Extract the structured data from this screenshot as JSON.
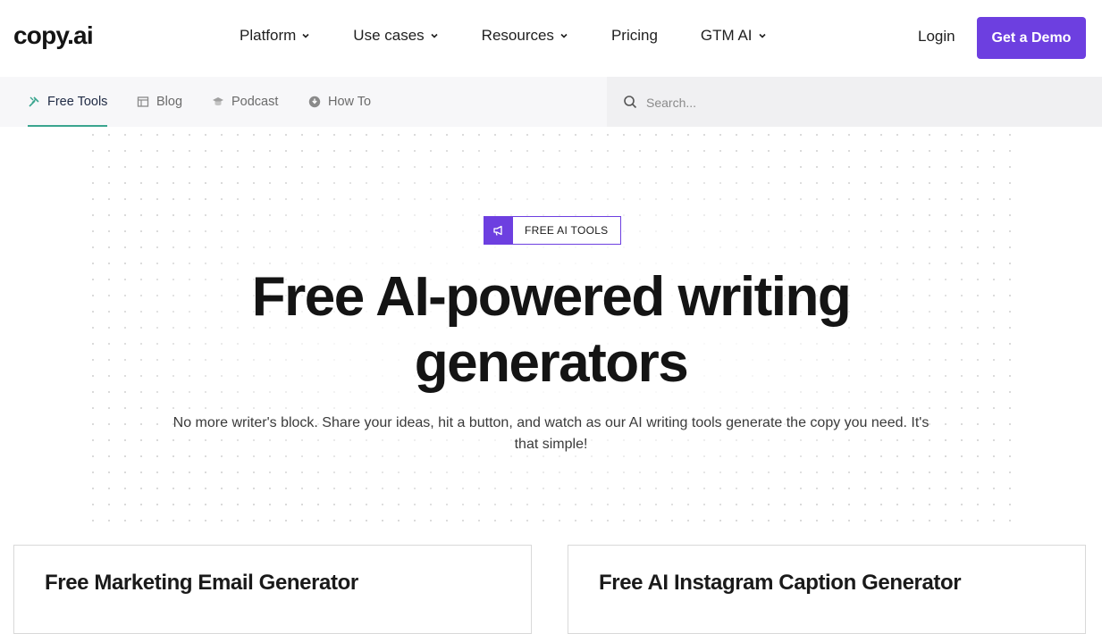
{
  "brand": {
    "logo_text": "copy.ai",
    "accent": "#6d3fe0",
    "tab_underline": "#3aa58f"
  },
  "nav": {
    "items": [
      {
        "label": "Platform",
        "has_dropdown": true
      },
      {
        "label": "Use cases",
        "has_dropdown": true
      },
      {
        "label": "Resources",
        "has_dropdown": true
      },
      {
        "label": "Pricing",
        "has_dropdown": false
      },
      {
        "label": "GTM AI",
        "has_dropdown": true
      }
    ],
    "login_label": "Login",
    "demo_label": "Get a Demo"
  },
  "subnav": {
    "items": [
      {
        "label": "Free Tools",
        "icon": "tools-icon",
        "active": true
      },
      {
        "label": "Blog",
        "icon": "blog-icon",
        "active": false
      },
      {
        "label": "Podcast",
        "icon": "podcast-icon",
        "active": false
      },
      {
        "label": "How To",
        "icon": "how-to-icon",
        "active": false
      }
    ]
  },
  "search": {
    "placeholder": "Search..."
  },
  "hero": {
    "badge": "FREE AI TOOLS",
    "headline_line1": "Free AI-powered writing",
    "headline_line2": "generators",
    "subtitle": "No more writer's block. Share your ideas, hit a button, and watch as our AI writing tools generate the copy you need. It's that simple!"
  },
  "cards": [
    {
      "title": "Free Marketing Email Generator"
    },
    {
      "title": "Free AI Instagram Caption Generator"
    }
  ]
}
